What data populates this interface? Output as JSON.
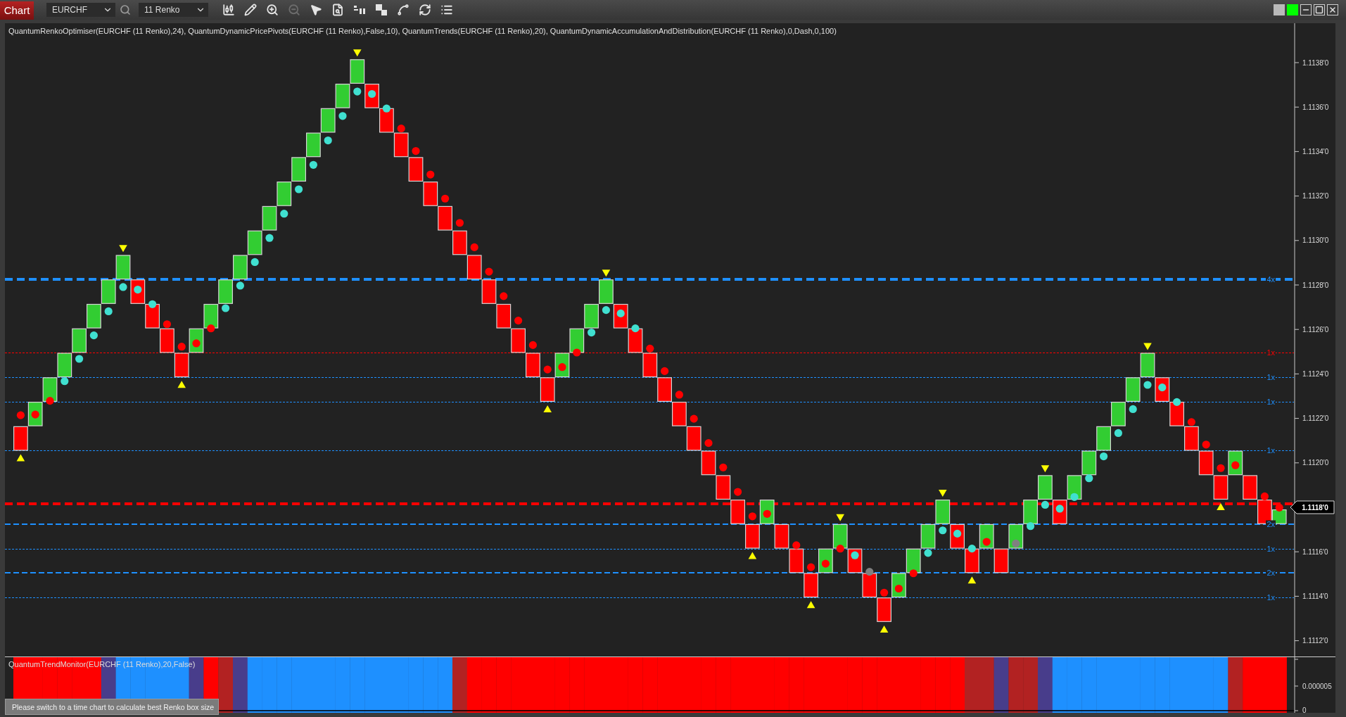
{
  "toolbar": {
    "tab": "Chart",
    "symbol": "EURCHF",
    "bar_type": "11 Renko",
    "tools": [
      {
        "disabled": false
      },
      {
        "disabled": false
      },
      {
        "disabled": false
      },
      {
        "disabled": true
      },
      {
        "disabled": false
      },
      {
        "disabled": false
      },
      {
        "disabled": false
      },
      {
        "disabled": false
      },
      {
        "disabled": false
      },
      {
        "disabled": false
      },
      {
        "disabled": false
      }
    ]
  },
  "window_controls": {
    "status_lights": [
      {
        "color": "#b9b9b9"
      },
      {
        "color": "#00ff00"
      }
    ]
  },
  "chart": {
    "indicators": "QuantumRenkoOptimiser(EURCHF (11 Renko),24), QuantumDynamicPricePivots(EURCHF (11 Renko),False,10), QuantumTrends(EURCHF (11 Renko),20), QuantumDynamicAccumulationAndDistribution(EURCHF (11 Renko),0,Dash,0,100)",
    "bricks": [
      {
        "kind": "down",
        "pivot": true,
        "dot": {
          "color": "#ff0000"
        }
      },
      {
        "kind": "up",
        "pivot": false,
        "dot": {
          "color": "#ff0000"
        }
      },
      {
        "kind": "up",
        "pivot": false,
        "dot": {
          "color": "#ff0000"
        }
      },
      {
        "kind": "up",
        "pivot": false,
        "dot": {
          "color": "#40e0d0"
        }
      },
      {
        "kind": "up",
        "pivot": false,
        "dot": {
          "color": "#40e0d0"
        }
      },
      {
        "kind": "up",
        "pivot": false,
        "dot": {
          "color": "#40e0d0"
        }
      },
      {
        "kind": "up",
        "pivot": false,
        "dot": {
          "color": "#40e0d0"
        }
      },
      {
        "kind": "up",
        "pivot": true,
        "dot": {
          "color": "#40e0d0"
        }
      },
      {
        "kind": "down",
        "pivot": false,
        "dot": {
          "color": "#40e0d0"
        }
      },
      {
        "kind": "down",
        "pivot": false,
        "dot": {
          "color": "#40e0d0"
        }
      },
      {
        "kind": "down",
        "pivot": false,
        "dot": {
          "color": "#ff0000"
        }
      },
      {
        "kind": "down",
        "pivot": true,
        "dot": {
          "color": "#ff0000"
        }
      },
      {
        "kind": "up",
        "pivot": false,
        "dot": {
          "color": "#ff0000"
        }
      },
      {
        "kind": "up",
        "pivot": false,
        "dot": {
          "color": "#ff0000"
        }
      },
      {
        "kind": "up",
        "pivot": false,
        "dot": {
          "color": "#40e0d0"
        }
      },
      {
        "kind": "up",
        "pivot": false,
        "dot": {
          "color": "#40e0d0"
        }
      },
      {
        "kind": "up",
        "pivot": false,
        "dot": {
          "color": "#40e0d0"
        }
      },
      {
        "kind": "up",
        "pivot": false,
        "dot": {
          "color": "#40e0d0"
        }
      },
      {
        "kind": "up",
        "pivot": false,
        "dot": {
          "color": "#40e0d0"
        }
      },
      {
        "kind": "up",
        "pivot": false,
        "dot": {
          "color": "#40e0d0"
        }
      },
      {
        "kind": "up",
        "pivot": false,
        "dot": {
          "color": "#40e0d0"
        }
      },
      {
        "kind": "up",
        "pivot": false,
        "dot": {
          "color": "#40e0d0"
        }
      },
      {
        "kind": "up",
        "pivot": false,
        "dot": {
          "color": "#40e0d0"
        }
      },
      {
        "kind": "up",
        "pivot": true,
        "dot": {
          "color": "#40e0d0"
        }
      },
      {
        "kind": "down",
        "pivot": false,
        "dot": {
          "color": "#40e0d0"
        }
      },
      {
        "kind": "down",
        "pivot": false,
        "dot": {
          "color": "#40e0d0"
        }
      },
      {
        "kind": "down",
        "pivot": false,
        "dot": {
          "color": "#ff0000"
        }
      },
      {
        "kind": "down",
        "pivot": false,
        "dot": {
          "color": "#ff0000"
        }
      },
      {
        "kind": "down",
        "pivot": false,
        "dot": {
          "color": "#ff0000"
        }
      },
      {
        "kind": "down",
        "pivot": false,
        "dot": {
          "color": "#ff0000"
        }
      },
      {
        "kind": "down",
        "pivot": false,
        "dot": {
          "color": "#ff0000"
        }
      },
      {
        "kind": "down",
        "pivot": false,
        "dot": {
          "color": "#ff0000"
        }
      },
      {
        "kind": "down",
        "pivot": false,
        "dot": {
          "color": "#ff0000"
        }
      },
      {
        "kind": "down",
        "pivot": false,
        "dot": {
          "color": "#ff0000"
        }
      },
      {
        "kind": "down",
        "pivot": false,
        "dot": {
          "color": "#ff0000"
        }
      },
      {
        "kind": "down",
        "pivot": false,
        "dot": {
          "color": "#ff0000"
        }
      },
      {
        "kind": "down",
        "pivot": true,
        "dot": {
          "color": "#ff0000"
        }
      },
      {
        "kind": "up",
        "pivot": false,
        "dot": {
          "color": "#ff0000"
        }
      },
      {
        "kind": "up",
        "pivot": false,
        "dot": {
          "color": "#ff0000"
        }
      },
      {
        "kind": "up",
        "pivot": false,
        "dot": {
          "color": "#40e0d0"
        }
      },
      {
        "kind": "up",
        "pivot": true,
        "dot": {
          "color": "#40e0d0"
        }
      },
      {
        "kind": "down",
        "pivot": false,
        "dot": {
          "color": "#40e0d0"
        }
      },
      {
        "kind": "down",
        "pivot": false,
        "dot": {
          "color": "#40e0d0"
        }
      },
      {
        "kind": "down",
        "pivot": false,
        "dot": {
          "color": "#ff0000"
        }
      },
      {
        "kind": "down",
        "pivot": false,
        "dot": {
          "color": "#ff0000"
        }
      },
      {
        "kind": "down",
        "pivot": false,
        "dot": {
          "color": "#ff0000"
        }
      },
      {
        "kind": "down",
        "pivot": false,
        "dot": {
          "color": "#ff0000"
        }
      },
      {
        "kind": "down",
        "pivot": false,
        "dot": {
          "color": "#ff0000"
        }
      },
      {
        "kind": "down",
        "pivot": false,
        "dot": {
          "color": "#ff0000"
        }
      },
      {
        "kind": "down",
        "pivot": false,
        "dot": {
          "color": "#ff0000"
        }
      },
      {
        "kind": "down",
        "pivot": true,
        "dot": {
          "color": "#ff0000"
        }
      },
      {
        "kind": "up",
        "pivot": false,
        "dot": {
          "color": "#ff0000"
        }
      },
      {
        "kind": "down",
        "pivot": false
      },
      {
        "kind": "down",
        "pivot": false,
        "dot": {
          "color": "#ff0000"
        }
      },
      {
        "kind": "down",
        "pivot": true,
        "dot": {
          "color": "#ff0000"
        }
      },
      {
        "kind": "up",
        "pivot": false,
        "dot": {
          "color": "#ff0000"
        }
      },
      {
        "kind": "up",
        "pivot": true,
        "dot": {
          "color": "#ff0000"
        }
      },
      {
        "kind": "down",
        "pivot": false,
        "dot": {
          "color": "#40e0d0"
        }
      },
      {
        "kind": "down",
        "pivot": false,
        "dot": {
          "color": "#808080"
        }
      },
      {
        "kind": "down",
        "pivot": true,
        "dot": {
          "color": "#ff0000"
        }
      },
      {
        "kind": "up",
        "pivot": false,
        "dot": {
          "color": "#ff0000"
        }
      },
      {
        "kind": "up",
        "pivot": false,
        "dot": {
          "color": "#ff0000"
        }
      },
      {
        "kind": "up",
        "pivot": false,
        "dot": {
          "color": "#40e0d0"
        }
      },
      {
        "kind": "up",
        "pivot": true,
        "dot": {
          "color": "#40e0d0"
        }
      },
      {
        "kind": "down",
        "pivot": false,
        "dot": {
          "color": "#40e0d0"
        }
      },
      {
        "kind": "down",
        "pivot": true,
        "dot": {
          "color": "#40e0d0"
        }
      },
      {
        "kind": "up",
        "pivot": false,
        "dot": {
          "color": "#ff0000"
        }
      },
      {
        "kind": "down",
        "pivot": false
      },
      {
        "kind": "up",
        "pivot": false,
        "dot": {
          "color": "#808080"
        }
      },
      {
        "kind": "up",
        "pivot": false,
        "dot": {
          "color": "#40e0d0"
        }
      },
      {
        "kind": "up",
        "pivot": true,
        "dot": {
          "color": "#40e0d0"
        }
      },
      {
        "kind": "down",
        "pivot": false,
        "dot": {
          "color": "#40e0d0"
        }
      },
      {
        "kind": "up",
        "pivot": false,
        "dot": {
          "color": "#40e0d0"
        }
      },
      {
        "kind": "up",
        "pivot": false,
        "dot": {
          "color": "#40e0d0"
        }
      },
      {
        "kind": "up",
        "pivot": false,
        "dot": {
          "color": "#40e0d0"
        }
      },
      {
        "kind": "up",
        "pivot": false,
        "dot": {
          "color": "#40e0d0"
        }
      },
      {
        "kind": "up",
        "pivot": false,
        "dot": {
          "color": "#40e0d0"
        }
      },
      {
        "kind": "up",
        "pivot": true,
        "dot": {
          "color": "#40e0d0"
        }
      },
      {
        "kind": "down",
        "pivot": false,
        "dot": {
          "color": "#40e0d0"
        }
      },
      {
        "kind": "down",
        "pivot": false,
        "dot": {
          "color": "#40e0d0"
        }
      },
      {
        "kind": "down",
        "pivot": false,
        "dot": {
          "color": "#ff0000"
        }
      },
      {
        "kind": "down",
        "pivot": false,
        "dot": {
          "color": "#ff0000"
        }
      },
      {
        "kind": "down",
        "pivot": true,
        "dot": {
          "color": "#ff0000"
        }
      },
      {
        "kind": "up",
        "pivot": false,
        "dot": {
          "color": "#ff0000"
        }
      },
      {
        "kind": "down",
        "pivot": false
      },
      {
        "kind": "down",
        "pivot": false,
        "dot": {
          "color": "#ff0000"
        }
      }
    ],
    "forming_brick": {
      "kind": "up",
      "level": 0.6,
      "dot": {
        "color": "#ff0000"
      }
    },
    "levels": [
      {
        "label": "4x",
        "color": "#1e90ff",
        "kind": "heavy"
      },
      {
        "label": "1x",
        "color": "#ff0000",
        "kind": "light"
      },
      {
        "label": "1x",
        "color": "#1e90ff",
        "kind": "light"
      },
      {
        "label": "1x",
        "color": "#1e90ff",
        "kind": "light"
      },
      {
        "label": "1x",
        "color": "#1e90ff",
        "kind": "light"
      },
      {
        "color": "#ff0000",
        "kind": "heavy"
      },
      {
        "label": "2x",
        "color": "#1e90ff",
        "kind": "medium"
      },
      {
        "label": "1x",
        "color": "#1e90ff",
        "kind": "light"
      },
      {
        "label": "2x",
        "color": "#1e90ff",
        "kind": "medium"
      },
      {
        "label": "1x",
        "color": "#1e90ff",
        "kind": "light"
      }
    ],
    "price_axis": [
      {
        "label": "1.1138'0",
        "kind": "tick"
      },
      {
        "label": "1.1136'0",
        "kind": "tick"
      },
      {
        "label": "1.1134'0",
        "kind": "tick"
      },
      {
        "label": "1.1132'0",
        "kind": "tick"
      },
      {
        "label": "1.1130'0",
        "kind": "tick"
      },
      {
        "label": "1.1128'0",
        "kind": "tick"
      },
      {
        "label": "1.1126'0",
        "kind": "tick"
      },
      {
        "label": "1.1124'0",
        "kind": "tick"
      },
      {
        "label": "1.1122'0",
        "kind": "tick"
      },
      {
        "label": "1.1120'0",
        "kind": "tick"
      },
      {
        "label": "1.1118'0",
        "kind": "current"
      },
      {
        "label": "1.1116'0",
        "kind": "tick"
      },
      {
        "label": "1.1114'0",
        "kind": "tick"
      },
      {
        "label": "1.1112'0",
        "kind": "tick"
      }
    ]
  },
  "trend_monitor": {
    "title": "QuantumTrendMonitor(EURCHF (11 Renko),20,False)",
    "bars": [
      {
        "color": "#ff0000"
      },
      {
        "color": "#ff0000"
      },
      {
        "color": "#ff0000"
      },
      {
        "color": "#ff0000"
      },
      {
        "color": "#ff0000"
      },
      {
        "color": "#ff0000"
      },
      {
        "color": "#483d8b"
      },
      {
        "color": "#1e90ff"
      },
      {
        "color": "#1e90ff"
      },
      {
        "color": "#1e90ff"
      },
      {
        "color": "#1e90ff"
      },
      {
        "color": "#1e90ff"
      },
      {
        "color": "#483d8b"
      },
      {
        "color": "#ff0000"
      },
      {
        "color": "#b22222"
      },
      {
        "color": "#483d8b"
      },
      {
        "color": "#1e90ff"
      },
      {
        "color": "#1e90ff"
      },
      {
        "color": "#1e90ff"
      },
      {
        "color": "#1e90ff"
      },
      {
        "color": "#1e90ff"
      },
      {
        "color": "#1e90ff"
      },
      {
        "color": "#1e90ff"
      },
      {
        "color": "#1e90ff"
      },
      {
        "color": "#1e90ff"
      },
      {
        "color": "#1e90ff"
      },
      {
        "color": "#1e90ff"
      },
      {
        "color": "#1e90ff"
      },
      {
        "color": "#1e90ff"
      },
      {
        "color": "#1e90ff"
      },
      {
        "color": "#b22222"
      },
      {
        "color": "#ff0000"
      },
      {
        "color": "#ff0000"
      },
      {
        "color": "#ff0000"
      },
      {
        "color": "#ff0000"
      },
      {
        "color": "#ff0000"
      },
      {
        "color": "#ff0000"
      },
      {
        "color": "#ff0000"
      },
      {
        "color": "#ff0000"
      },
      {
        "color": "#ff0000"
      },
      {
        "color": "#ff0000"
      },
      {
        "color": "#ff0000"
      },
      {
        "color": "#ff0000"
      },
      {
        "color": "#ff0000"
      },
      {
        "color": "#ff0000"
      },
      {
        "color": "#ff0000"
      },
      {
        "color": "#ff0000"
      },
      {
        "color": "#ff0000"
      },
      {
        "color": "#ff0000"
      },
      {
        "color": "#ff0000"
      },
      {
        "color": "#ff0000"
      },
      {
        "color": "#ff0000"
      },
      {
        "color": "#ff0000"
      },
      {
        "color": "#ff0000"
      },
      {
        "color": "#ff0000"
      },
      {
        "color": "#ff0000"
      },
      {
        "color": "#ff0000"
      },
      {
        "color": "#ff0000"
      },
      {
        "color": "#ff0000"
      },
      {
        "color": "#ff0000"
      },
      {
        "color": "#ff0000"
      },
      {
        "color": "#ff0000"
      },
      {
        "color": "#ff0000"
      },
      {
        "color": "#ff0000"
      },
      {
        "color": "#ff0000"
      },
      {
        "color": "#b22222"
      },
      {
        "color": "#b22222"
      },
      {
        "color": "#483d8b"
      },
      {
        "color": "#b22222"
      },
      {
        "color": "#b22222"
      },
      {
        "color": "#483d8b"
      },
      {
        "color": "#1e90ff"
      },
      {
        "color": "#1e90ff"
      },
      {
        "color": "#1e90ff"
      },
      {
        "color": "#1e90ff"
      },
      {
        "color": "#1e90ff"
      },
      {
        "color": "#1e90ff"
      },
      {
        "color": "#1e90ff"
      },
      {
        "color": "#1e90ff"
      },
      {
        "color": "#1e90ff"
      },
      {
        "color": "#1e90ff"
      },
      {
        "color": "#1e90ff"
      },
      {
        "color": "#1e90ff"
      },
      {
        "color": "#b22222"
      },
      {
        "color": "#ff0000"
      },
      {
        "color": "#ff0000"
      },
      {
        "color": "#ff0000"
      }
    ],
    "axis": [
      "0.000005",
      "0"
    ]
  },
  "notice": "Please switch to a time chart to calculate best Renko box size"
}
